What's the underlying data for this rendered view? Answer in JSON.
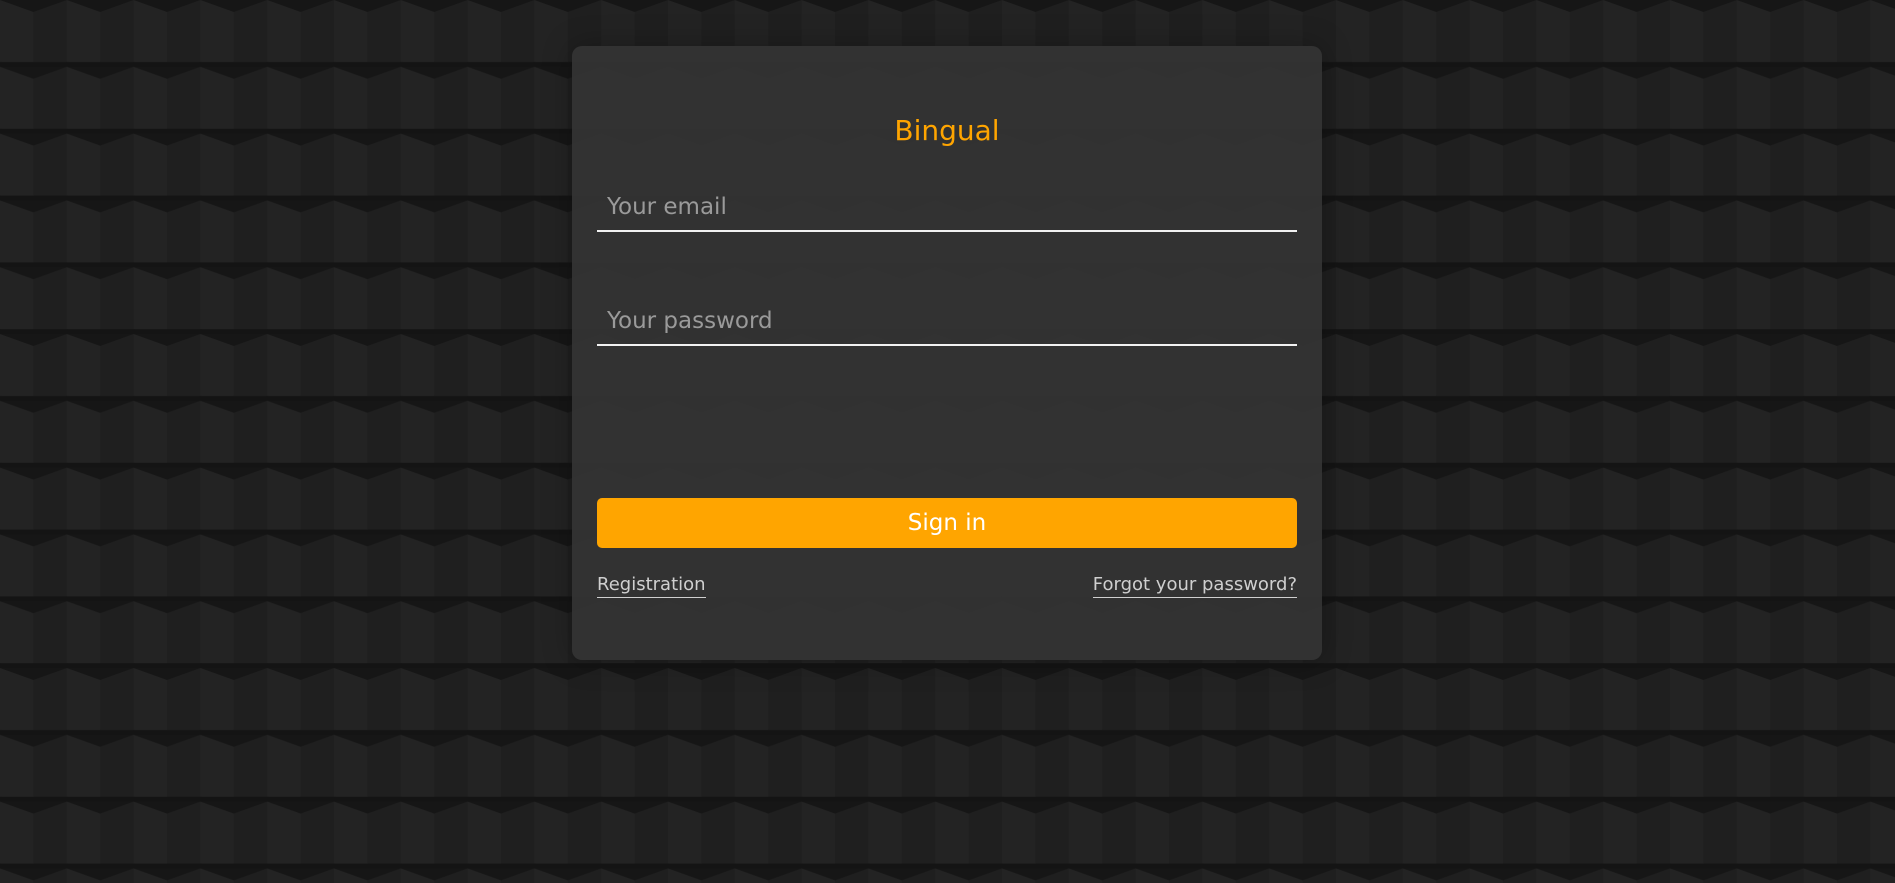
{
  "app": {
    "title": "Bingual"
  },
  "form": {
    "email_placeholder": "Your email",
    "email_value": "",
    "password_placeholder": "Your password",
    "password_value": "",
    "submit_label": "Sign in"
  },
  "links": {
    "registration": "Registration",
    "forgot_password": "Forgot your password?"
  },
  "colors": {
    "accent": "#ffa500",
    "background": "#1b1b1b",
    "card": "#343434"
  }
}
